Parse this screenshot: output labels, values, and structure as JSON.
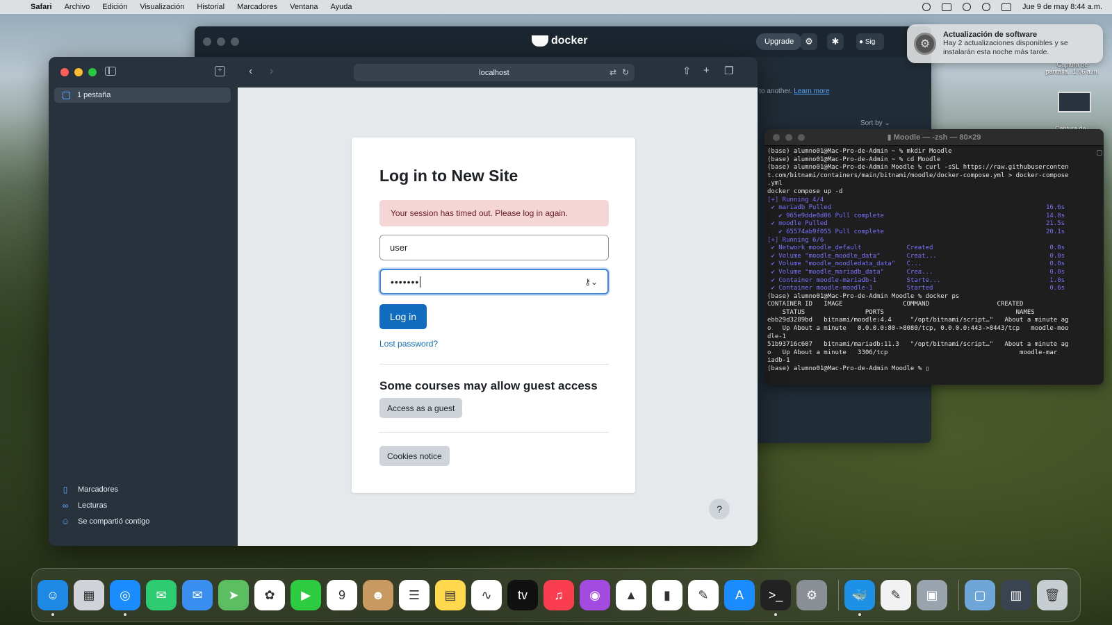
{
  "menubar": {
    "app": "Safari",
    "items": [
      "Archivo",
      "Edición",
      "Visualización",
      "Historial",
      "Marcadores",
      "Ventana",
      "Ayuda"
    ],
    "clock": "Jue 9 de may  8:44 a.m."
  },
  "docker": {
    "logo": "docker",
    "upgrade": "Upgrade",
    "user_partial": "Sig",
    "hint_text": "nent to another.",
    "learn_more": "Learn more",
    "sort_by": "Sort by"
  },
  "notification": {
    "title": "Actualización de software",
    "body": "Hay 2 actualizaciones disponibles y se instalarán esta noche más tarde."
  },
  "desktop": {
    "file1": "Captura de pantalla...1.06 a.m.",
    "file2": "Captura de"
  },
  "terminal": {
    "title": "Moodle — -zsh — 80×29",
    "lines": [
      {
        "t": "(base) alumno01@Mac-Pro-de-Admin ~ % mkdir Moodle",
        "c": ""
      },
      {
        "t": "(base) alumno01@Mac-Pro-de-Admin ~ % cd Moodle",
        "c": ""
      },
      {
        "t": "(base) alumno01@Mac-Pro-de-Admin Moodle % curl -sSL https://raw.githubuserconten",
        "c": ""
      },
      {
        "t": "t.com/bitnami/containers/main/bitnami/moodle/docker-compose.yml > docker-compose",
        "c": ""
      },
      {
        "t": ".yml",
        "c": ""
      },
      {
        "t": "docker compose up -d",
        "c": ""
      },
      {
        "t": "[+] Running 4/4",
        "c": "blue"
      },
      {
        "t": " ✔ mariadb Pulled                                                         16.6s",
        "c": "blue"
      },
      {
        "t": "   ✔ 965e9dde0d06 Pull complete                                           14.8s",
        "c": "blue"
      },
      {
        "t": " ✔ moodle Pulled                                                          21.5s",
        "c": "blue"
      },
      {
        "t": "   ✔ 65574ab9f055 Pull complete                                           20.1s",
        "c": "blue"
      },
      {
        "t": "[+] Running 6/6",
        "c": "blue"
      },
      {
        "t": " ✔ Network moodle_default            Created                               0.0s",
        "c": "blue"
      },
      {
        "t": " ✔ Volume \"moodle_moodle_data\"       Creat...                              0.0s",
        "c": "blue"
      },
      {
        "t": " ✔ Volume \"moodle_moodledata_data\"   C...                                  0.0s",
        "c": "blue"
      },
      {
        "t": " ✔ Volume \"moodle_mariadb_data\"      Crea...                               0.0s",
        "c": "blue"
      },
      {
        "t": " ✔ Container moodle-mariadb-1        Starte...                             1.0s",
        "c": "blue"
      },
      {
        "t": " ✔ Container moodle-moodle-1         Started                               0.6s",
        "c": "blue"
      },
      {
        "t": "(base) alumno01@Mac-Pro-de-Admin Moodle % docker ps",
        "c": ""
      },
      {
        "t": "CONTAINER ID   IMAGE                COMMAND                  CREATED",
        "c": ""
      },
      {
        "t": "    STATUS                PORTS                                   NAMES",
        "c": ""
      },
      {
        "t": "ebb29d3289bd   bitnami/moodle:4.4     \"/opt/bitnami/script…\"   About a minute ag",
        "c": ""
      },
      {
        "t": "o   Up About a minute   0.0.0.0:80->8080/tcp, 0.0.0.0:443->8443/tcp   moodle-moo",
        "c": ""
      },
      {
        "t": "dle-1",
        "c": ""
      },
      {
        "t": "51b93716c607   bitnami/mariadb:11.3   \"/opt/bitnami/script…\"   About a minute ag",
        "c": ""
      },
      {
        "t": "o   Up About a minute   3306/tcp                                   moodle-mar",
        "c": ""
      },
      {
        "t": "iadb-1",
        "c": ""
      },
      {
        "t": "(base) alumno01@Mac-Pro-de-Admin Moodle % ▯",
        "c": ""
      }
    ]
  },
  "safari": {
    "tab_group": "1 pestaña",
    "url": "localhost",
    "sidebar_bottom": [
      "Marcadores",
      "Lecturas",
      "Se compartió contigo"
    ]
  },
  "login": {
    "title": "Log in to New Site",
    "alert": "Your session has timed out. Please log in again.",
    "username": "user",
    "password_mask": "•••••••",
    "login_button": "Log in",
    "lost_password": "Lost password?",
    "guest_heading": "Some courses may allow guest access",
    "guest_button": "Access as a guest",
    "cookies_button": "Cookies notice",
    "help": "?"
  },
  "dock": {
    "apps": [
      {
        "name": "finder",
        "label": "☺",
        "color": "#1e88e5",
        "running": true
      },
      {
        "name": "launchpad",
        "label": "▦",
        "color": "#d0d4da",
        "running": false
      },
      {
        "name": "safari",
        "label": "◎",
        "color": "#1a8cff",
        "running": true
      },
      {
        "name": "messages",
        "label": "✉",
        "color": "#2ecc71",
        "running": false
      },
      {
        "name": "mail",
        "label": "✉",
        "color": "#3a8ef0",
        "running": false
      },
      {
        "name": "maps",
        "label": "➤",
        "color": "#5bbf62",
        "running": false
      },
      {
        "name": "photos",
        "label": "✿",
        "color": "#ffffff",
        "running": false
      },
      {
        "name": "facetime",
        "label": "▶",
        "color": "#2ecc40",
        "running": false
      },
      {
        "name": "calendar",
        "label": "9",
        "color": "#ffffff",
        "running": false
      },
      {
        "name": "contacts",
        "label": "☻",
        "color": "#c89a62",
        "running": false
      },
      {
        "name": "reminders",
        "label": "☰",
        "color": "#ffffff",
        "running": false
      },
      {
        "name": "notes",
        "label": "▤",
        "color": "#ffd84d",
        "running": false
      },
      {
        "name": "freeform",
        "label": "∿",
        "color": "#ffffff",
        "running": false
      },
      {
        "name": "tv",
        "label": "tv",
        "color": "#111111",
        "running": false
      },
      {
        "name": "music",
        "label": "♫",
        "color": "#fa3e4f",
        "running": false
      },
      {
        "name": "podcasts",
        "label": "◉",
        "color": "#a34be0",
        "running": false
      },
      {
        "name": "keynote",
        "label": "▲",
        "color": "#ffffff",
        "running": false
      },
      {
        "name": "numbers",
        "label": "▮",
        "color": "#ffffff",
        "running": false
      },
      {
        "name": "pages",
        "label": "✎",
        "color": "#ffffff",
        "running": false
      },
      {
        "name": "app-store",
        "label": "A",
        "color": "#1a8cff",
        "running": false
      },
      {
        "name": "terminal",
        "label": ">_",
        "color": "#222222",
        "running": true
      },
      {
        "name": "system-settings",
        "label": "⚙",
        "color": "#8a8f96",
        "running": false
      }
    ],
    "extra": [
      {
        "name": "docker",
        "label": "🐳",
        "color": "#1d91e6",
        "running": true
      },
      {
        "name": "textedit",
        "label": "✎",
        "color": "#f2f2f2",
        "running": false
      },
      {
        "name": "preview",
        "label": "▣",
        "color": "#9aa4ae",
        "running": false
      }
    ],
    "trailing": [
      {
        "name": "downloads",
        "label": "▢",
        "color": "#6fa6d8",
        "running": false
      },
      {
        "name": "recent-screenshots",
        "label": "▥",
        "color": "#3a4450",
        "running": false
      },
      {
        "name": "trash",
        "label": "🗑",
        "color": "#c8cdd2",
        "running": false
      }
    ]
  }
}
